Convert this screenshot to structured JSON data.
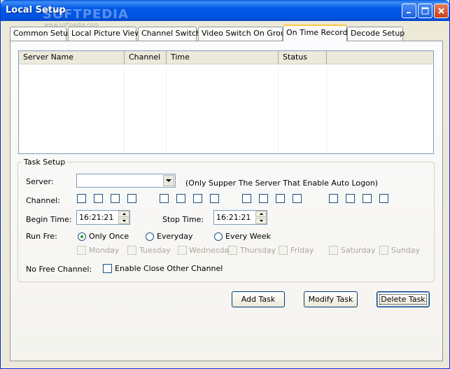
{
  "window": {
    "title": "Local Setup",
    "watermark": "SOFTPEDIA",
    "watermark_sub": "www.softpedia.com"
  },
  "tabs": [
    {
      "label": "Common Setup",
      "active": false
    },
    {
      "label": "Local Picture View",
      "active": false
    },
    {
      "label": "Channel Switch",
      "active": false
    },
    {
      "label": "Video Switch On Group",
      "active": false
    },
    {
      "label": "On Time Record",
      "active": true
    },
    {
      "label": "Decode Setup",
      "active": false
    }
  ],
  "list": {
    "columns": [
      "Server Name",
      "Channel",
      "Time",
      "Status"
    ],
    "rows": []
  },
  "task_setup": {
    "title": "Task Setup",
    "server_label": "Server:",
    "server_value": "",
    "server_note": "(Only Supper The Server That Enable Auto Logon)",
    "channel_label": "Channel:",
    "channel_count": 16,
    "begin_label": "Begin Time:",
    "begin_value": "16:21:21",
    "stop_label": "Stop Time:",
    "stop_value": "16:21:21",
    "runfre_label": "Run Fre:",
    "run_options": [
      "Only Once",
      "Everyday",
      "Every Week"
    ],
    "run_selected": "Only Once",
    "weekdays": [
      "Monday",
      "Tuesday",
      "Wednesday",
      "Thursday",
      "Friday",
      "Saturday",
      "Sunday"
    ],
    "nofree_label": "No Free Channel:",
    "enable_close_label": "Enable Close Other Channel"
  },
  "buttons": {
    "add": "Add Task",
    "modify": "Modify Task",
    "delete": "Delete Task"
  },
  "colors": {
    "titlebar": "#0054e3",
    "face": "#ece9d8",
    "radio_dot": "#24a024",
    "active_tab_accent": "#ffc83c"
  }
}
